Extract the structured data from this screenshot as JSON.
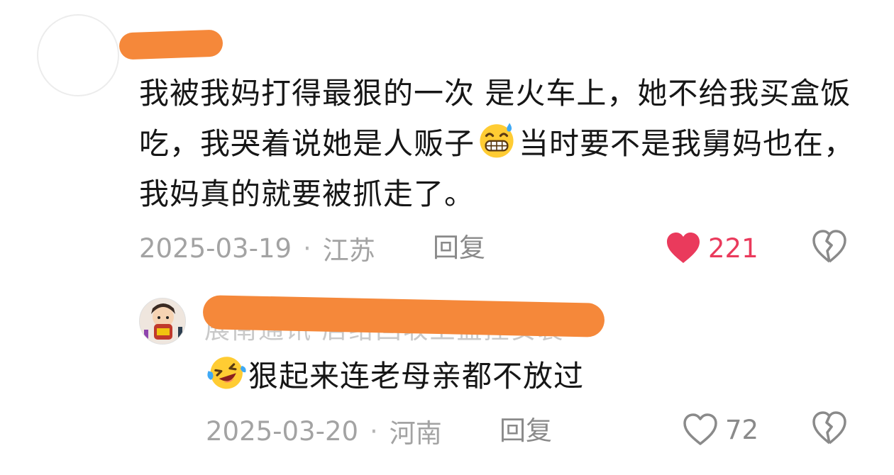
{
  "comment": {
    "text_parts": [
      "我被我妈打得最狠的一次 是火车上，她不给我买盒饭吃，我哭着说她是人贩子",
      "当时要不是我舅妈也在，我妈真的就要被抓走了。"
    ],
    "inline_emoji": "grinning-sweat-emoji",
    "date": "2025-03-19",
    "separator": "·",
    "location": "江苏",
    "reply_label": "回复",
    "likes": "221",
    "liked": true,
    "like_color": "#ea3a5c"
  },
  "reply": {
    "faded_name_text": "展南通讯        店给回收上监控安装",
    "leading_emoji": "laughing-crying-emoji",
    "text": "狠起来连老母亲都不放过",
    "date": "2025-03-20",
    "separator": "·",
    "location": "河南",
    "reply_label": "回复",
    "likes": "72",
    "liked": false
  },
  "colors": {
    "redaction": "#f5883a",
    "meta_text": "#a3a3a3",
    "body_text": "#161616"
  }
}
